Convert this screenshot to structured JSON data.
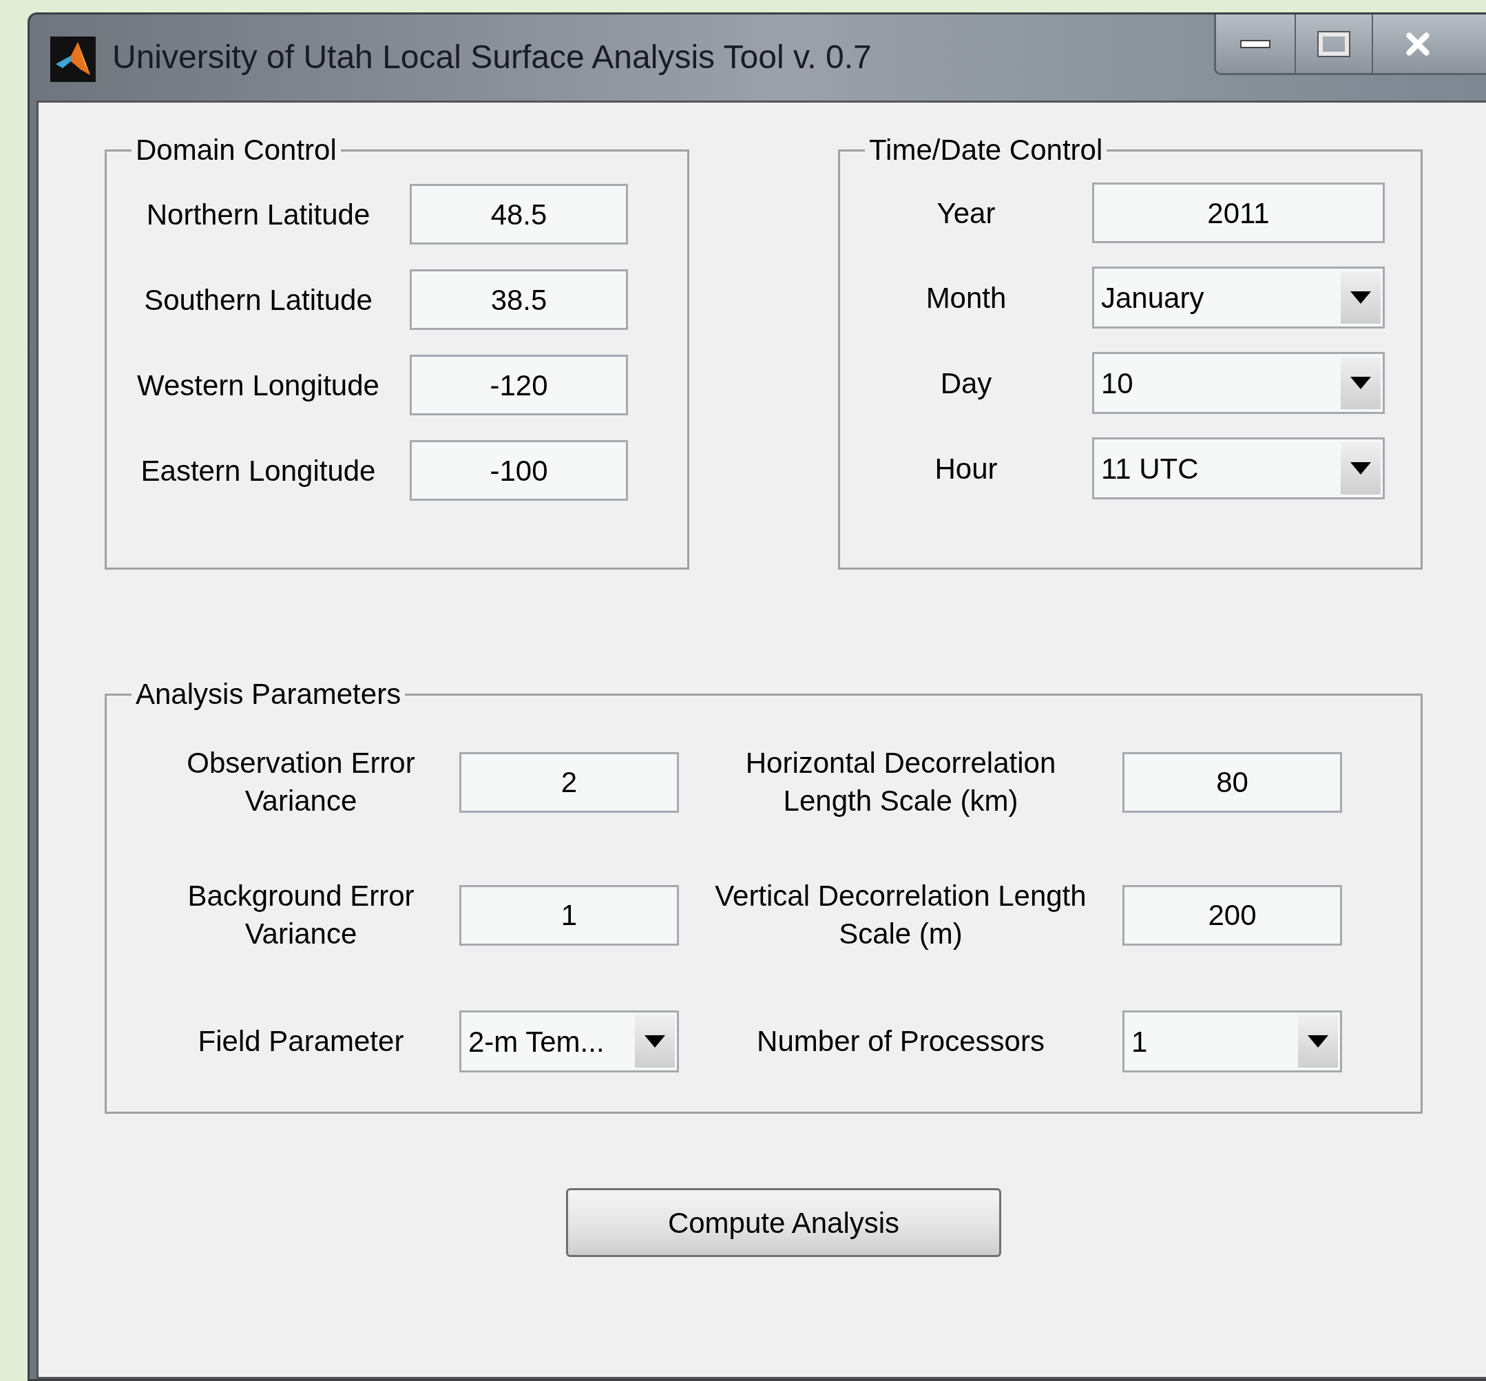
{
  "window": {
    "title": "University of Utah Local Surface Analysis Tool v. 0.7"
  },
  "domain_control": {
    "title": "Domain Control",
    "fields": [
      {
        "label": "Northern Latitude",
        "value": "48.5"
      },
      {
        "label": "Southern Latitude",
        "value": "38.5"
      },
      {
        "label": "Western Longitude",
        "value": "-120"
      },
      {
        "label": "Eastern Longitude",
        "value": "-100"
      }
    ]
  },
  "time_date_control": {
    "title": "Time/Date Control",
    "fields": [
      {
        "kind": "text",
        "label": "Year",
        "value": "2011"
      },
      {
        "kind": "dropdown",
        "label": "Month",
        "value": "January"
      },
      {
        "kind": "dropdown",
        "label": "Day",
        "value": "10"
      },
      {
        "kind": "dropdown",
        "label": "Hour",
        "value": "11 UTC"
      }
    ]
  },
  "analysis_parameters": {
    "title": "Analysis Parameters",
    "fields": [
      {
        "kind": "text",
        "label": "Observation Error Variance",
        "value": "2"
      },
      {
        "kind": "text",
        "label": "Horizontal Decorrelation Length Scale (km)",
        "value": "80"
      },
      {
        "kind": "text",
        "label": "Background Error Variance",
        "value": "1"
      },
      {
        "kind": "text",
        "label": "Vertical Decorrelation Length Scale (m)",
        "value": "200"
      },
      {
        "kind": "dropdown",
        "label": "Field Parameter",
        "value": "2-m Tem..."
      },
      {
        "kind": "dropdown",
        "label": "Number of Processors",
        "value": "1"
      }
    ]
  },
  "button": {
    "label": "Compute Analysis"
  }
}
